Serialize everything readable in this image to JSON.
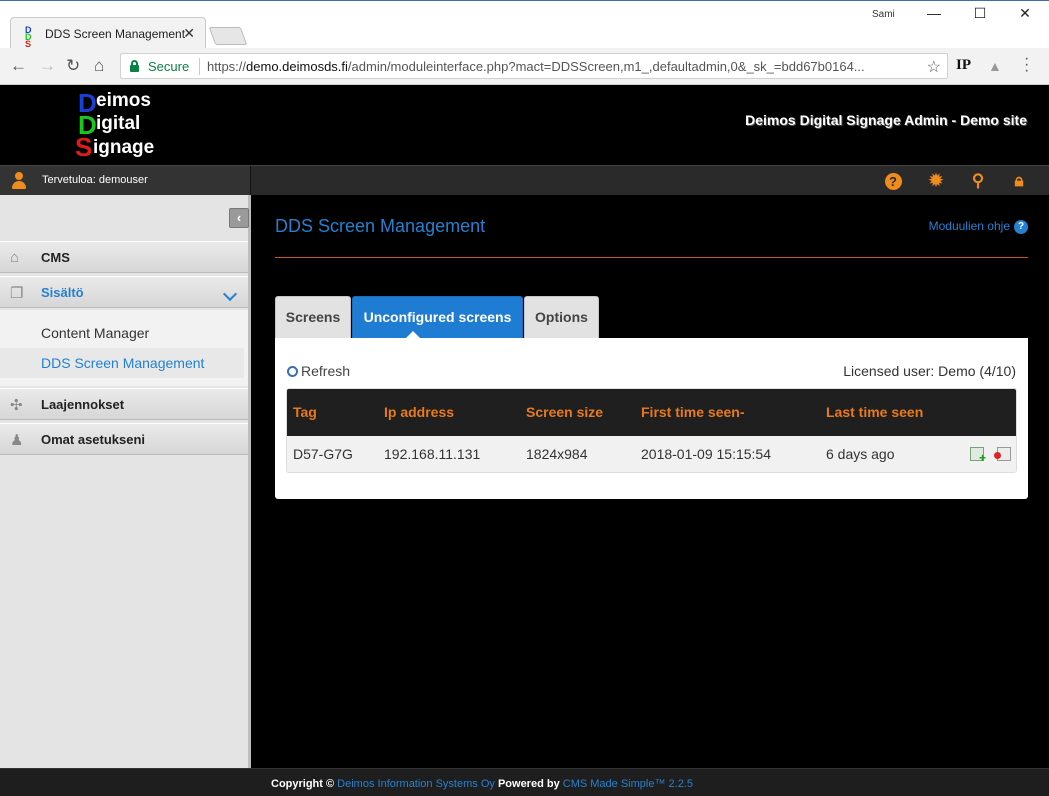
{
  "browser": {
    "tab_title": "DDS Screen Management",
    "tab_close": "✕",
    "user": "Sami",
    "secure_label": "Secure",
    "url_scheme": "https://",
    "url_host": "demo.deimosds.fi",
    "url_path": "/admin/moduleinterface.php?mact=DDSScreen,m1_,defaultadmin,0&_sk_=bdd67b0164...",
    "extension_ip": "IP"
  },
  "header": {
    "logo": {
      "line1_letter": "D",
      "line1_rest": "eimos",
      "line2_letter": "D",
      "line2_rest": "igital",
      "line3_letter": "S",
      "line3_rest": "ignage"
    },
    "site_title": "Deimos Digital Signage Admin - Demo site",
    "welcome": "Tervetuloa: demouser"
  },
  "sidebar": {
    "items": [
      {
        "label": "CMS"
      },
      {
        "label": "Sisältö"
      },
      {
        "label": "Laajennokset"
      },
      {
        "label": "Omat asetukseni"
      }
    ],
    "submenu": [
      {
        "label": "Content Manager"
      },
      {
        "label": "DDS Screen Management"
      }
    ]
  },
  "main": {
    "title": "DDS Screen Management",
    "help_link": "Moduulien ohje",
    "tabs": [
      {
        "label": "Screens"
      },
      {
        "label": "Unconfigured screens"
      },
      {
        "label": "Options"
      }
    ],
    "refresh_label": "Refresh",
    "licensed_user": "Licensed user: Demo (4/10)",
    "table": {
      "headers": [
        "Tag",
        "Ip address",
        "Screen size",
        "First time seen-",
        "Last time seen"
      ],
      "rows": [
        [
          "D57-G7G",
          "192.168.11.131",
          "1824x984",
          "2018-01-09 15:15:54",
          "6 days ago"
        ]
      ]
    }
  },
  "footer": {
    "copyright": "Copyright ©",
    "company": "Deimos Information Systems Oy",
    "powered_by": "Powered by",
    "cms": "CMS Made Simple™ 2.2.5"
  },
  "colors": {
    "accent_blue": "#2581d0",
    "accent_orange": "#e87a1d",
    "logo_blue": "#1a3fd6",
    "logo_green": "#19c919",
    "logo_red": "#e01b1b"
  }
}
